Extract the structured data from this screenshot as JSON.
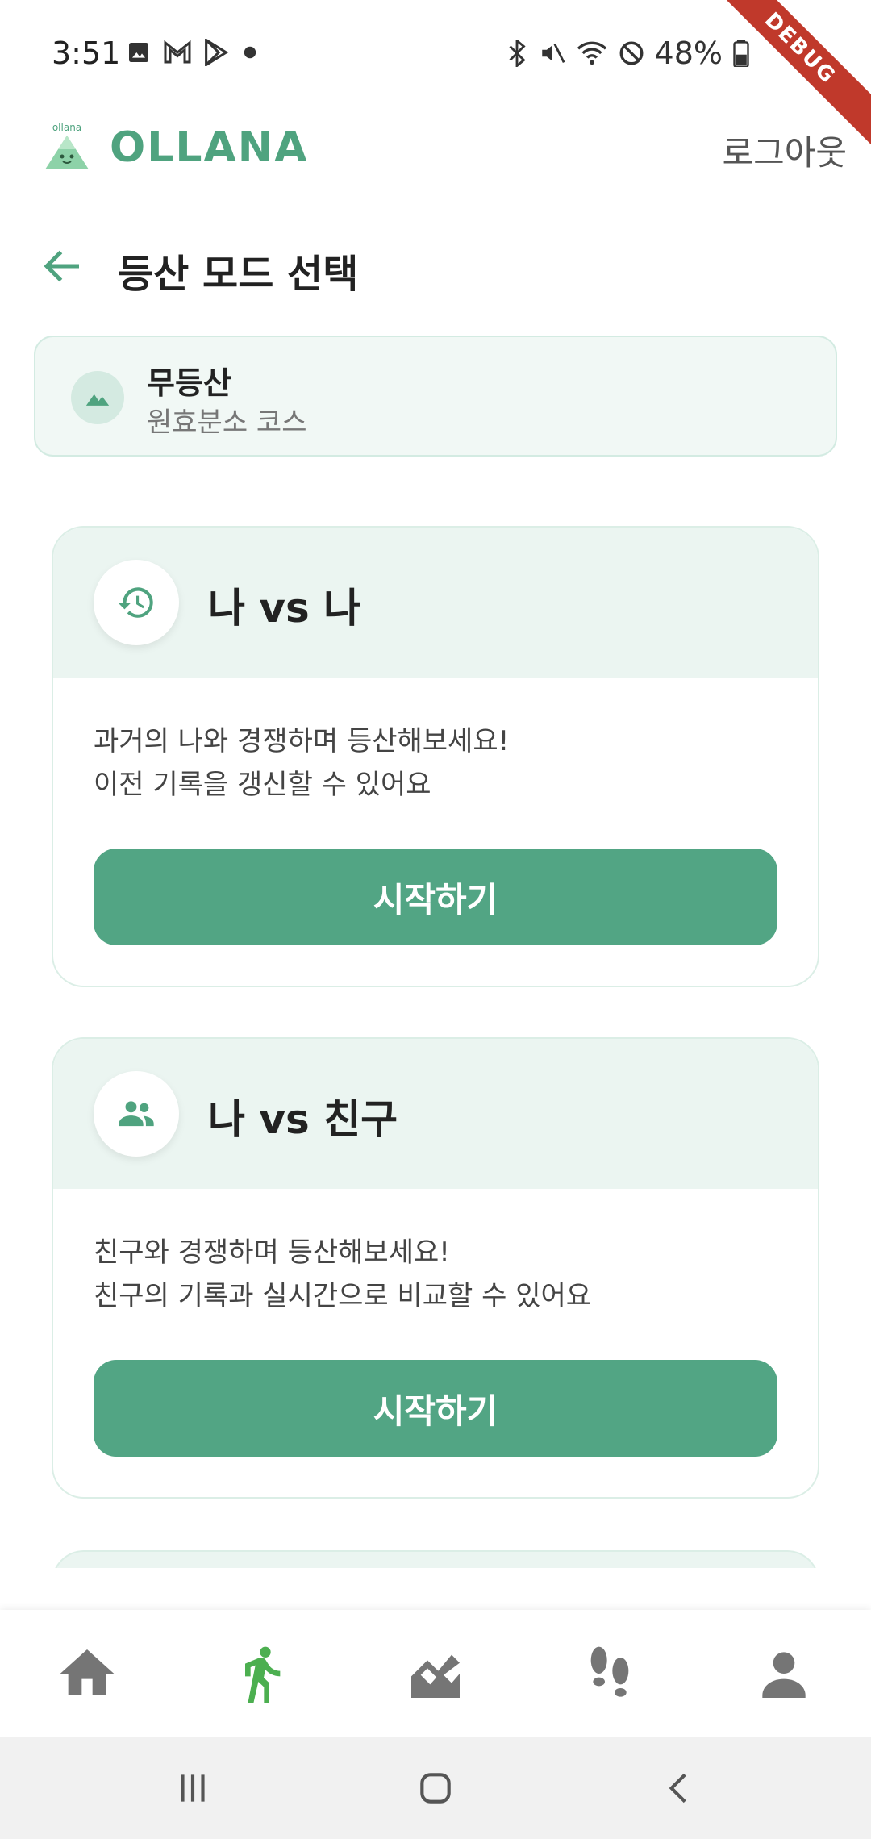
{
  "status_bar": {
    "time": "3:51",
    "battery": "48%",
    "left_icons": [
      "image-icon",
      "gmail-icon",
      "play-store-icon",
      "dot-icon"
    ],
    "right_icons": [
      "bluetooth-icon",
      "mute-icon",
      "wifi-icon",
      "dnd-icon",
      "battery-icon"
    ]
  },
  "debug_ribbon": "DEBUG",
  "header": {
    "logo_small_text": "ollana",
    "logo_text": "OLLANA",
    "logout_label": "로그아웃"
  },
  "page": {
    "title": "등산 모드 선택"
  },
  "mountain": {
    "name": "무등산",
    "course": "원효분소 코스"
  },
  "modes": [
    {
      "title": "나 vs 나",
      "icon": "history-icon",
      "desc_line1": "과거의 나와 경쟁하며 등산해보세요!",
      "desc_line2": "이전 기록을 갱신할 수 있어요",
      "button_label": "시작하기"
    },
    {
      "title": "나 vs 친구",
      "icon": "people-icon",
      "desc_line1": "친구와 경쟁하며 등산해보세요!",
      "desc_line2": "친구의 기록과 실시간으로 비교할 수 있어요",
      "button_label": "시작하기"
    }
  ],
  "bottom_nav": {
    "items": [
      "home-icon",
      "hiking-icon",
      "chart-icon",
      "footprints-icon",
      "person-icon"
    ],
    "active_index": 1,
    "active_color": "#4caf50",
    "inactive_color": "#757575"
  },
  "colors": {
    "accent": "#52a584",
    "card_header_bg": "#ebf5f1"
  }
}
